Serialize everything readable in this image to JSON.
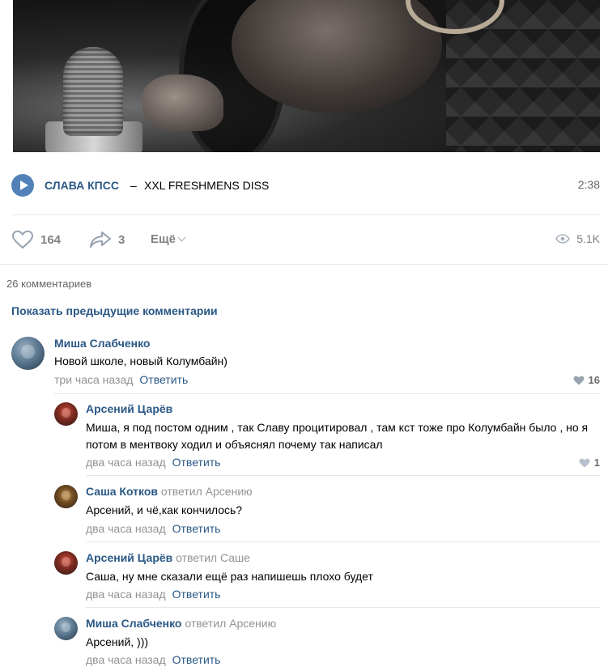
{
  "track": {
    "artist": "СЛАВА КПСС",
    "dash": "–",
    "title": "XXL FRESHMENS DISS",
    "duration": "2:38"
  },
  "actions": {
    "likes": "164",
    "shares": "3",
    "more_label": "Ещё",
    "views": "5.1K"
  },
  "comments_count": "26 комментариев",
  "show_previous": "Показать предыдущие комментарии",
  "comments": [
    {
      "author": "Миша Слабченко",
      "reply_to": "",
      "text": "Новой школе, новый Колумбайн)",
      "time": "три часа назад",
      "reply_label": "Ответить",
      "likes": "16"
    },
    {
      "author": "Арсений Царёв",
      "reply_to": "",
      "text": "Миша, я под постом одним , так Славу процитировал , там кст тоже про Колумбайн было , но я потом в ментвоку ходил и объяснял почему так написал",
      "time": "два часа назад",
      "reply_label": "Ответить",
      "likes": "1"
    },
    {
      "author": "Саша Котков",
      "reply_to": "ответил Арсению",
      "text": "Арсений, и чё,как кончилось?",
      "time": "два часа назад",
      "reply_label": "Ответить",
      "likes": ""
    },
    {
      "author": "Арсений Царёв",
      "reply_to": "ответил Саше",
      "text": "Саша, ну мне сказали ещё раз напишешь плохо будет",
      "time": "два часа назад",
      "reply_label": "Ответить",
      "likes": ""
    },
    {
      "author": "Миша Слабченко",
      "reply_to": "ответил Арсению",
      "text": "Арсений, )))",
      "time": "два часа назад",
      "reply_label": "Ответить",
      "likes": ""
    }
  ]
}
